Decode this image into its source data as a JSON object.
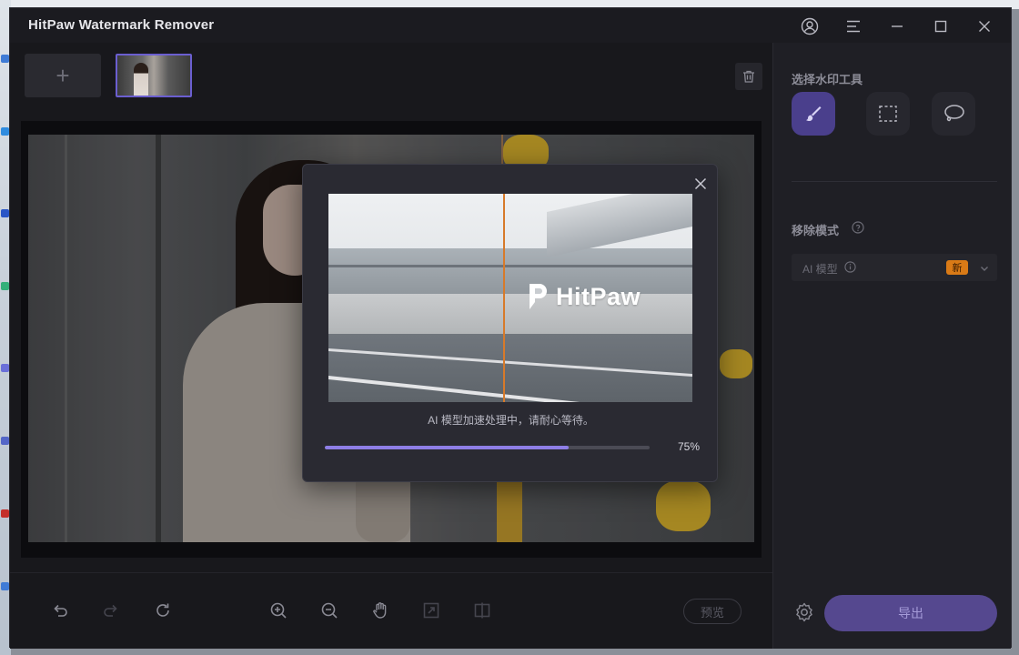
{
  "app": {
    "title": "HitPaw Watermark Remover"
  },
  "colors": {
    "accent": "#8e7ee6",
    "active_tool": "#4a3f8c",
    "export": "#55488f",
    "new_badge": "#d97a16"
  },
  "window_controls": [
    {
      "name": "account-icon"
    },
    {
      "name": "menu-icon"
    },
    {
      "name": "minimize-icon"
    },
    {
      "name": "maximize-icon"
    },
    {
      "name": "close-icon"
    }
  ],
  "toolbar": {
    "add_label": "+",
    "preview_label": "预览"
  },
  "side_panel": {
    "tool_section_title": "选择水印工具",
    "tools": [
      {
        "name": "brush-tool",
        "active": true
      },
      {
        "name": "rect-select-tool",
        "active": false
      },
      {
        "name": "lasso-tool",
        "active": false
      }
    ],
    "mode_section_title": "移除模式",
    "mode_value": "AI 模型",
    "new_badge": "新",
    "export_label": "导出"
  },
  "modal": {
    "logo_text": "HitPaw",
    "message": "AI 模型加速处理中，请耐心等待。",
    "progress": 75,
    "progress_label": "75%"
  }
}
